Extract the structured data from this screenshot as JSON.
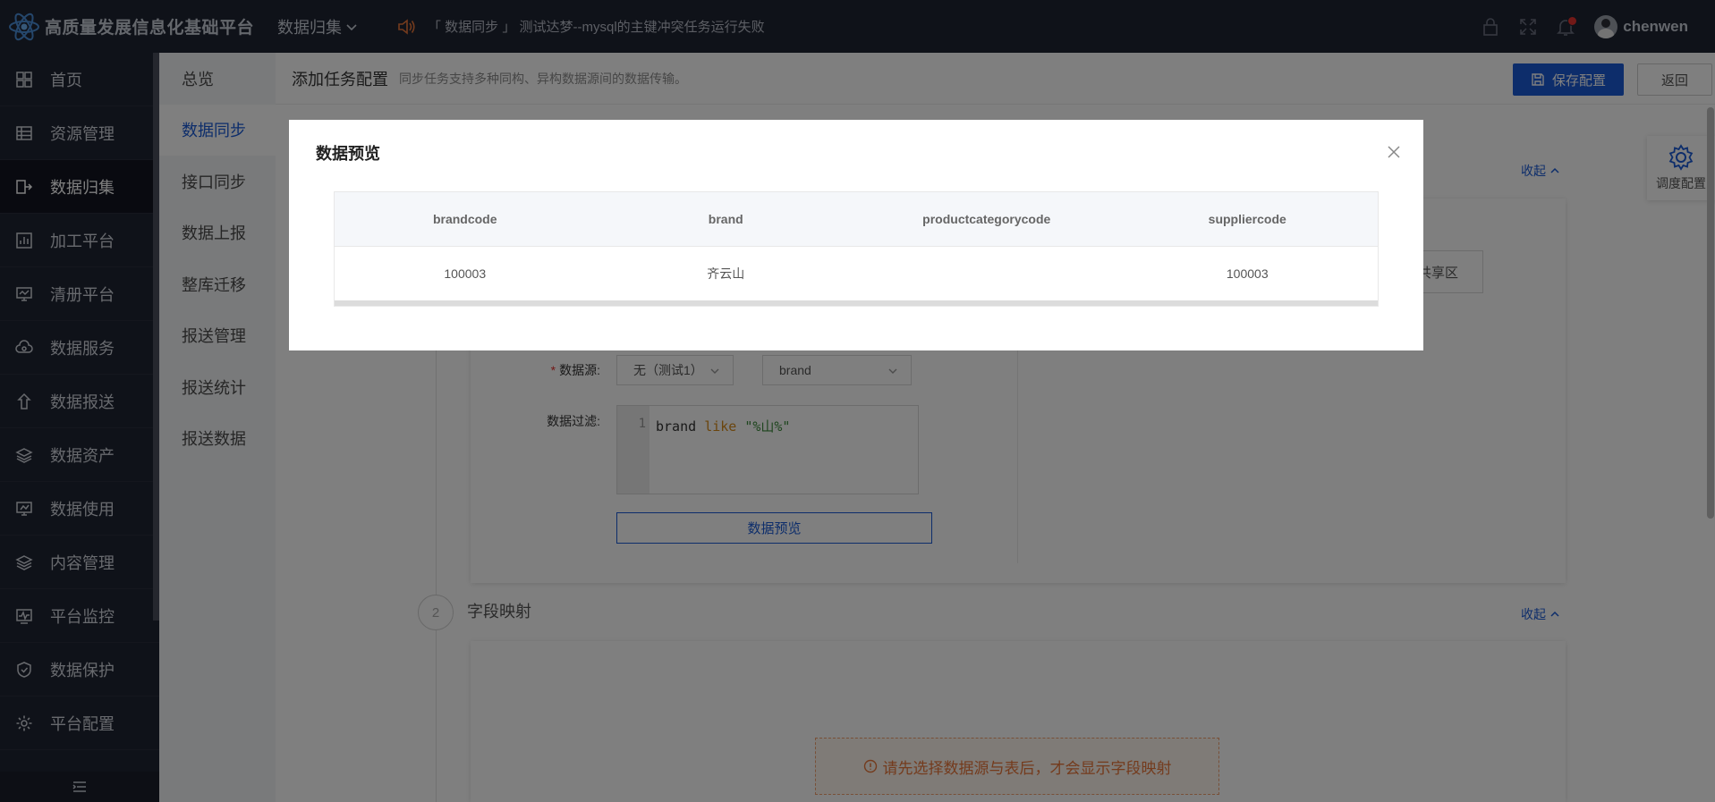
{
  "app": {
    "title": "高质量发展信息化基础平台",
    "module": "数据归集",
    "notice": "「 数据同步 」 测试达梦--mysql的主键冲突任务运行失败",
    "user": "chenwen"
  },
  "sidebar": {
    "items": [
      {
        "label": "首页",
        "icon": "dashboard-icon"
      },
      {
        "label": "资源管理",
        "icon": "table-icon"
      },
      {
        "label": "数据归集",
        "icon": "collect-icon"
      },
      {
        "label": "加工平台",
        "icon": "chart-icon"
      },
      {
        "label": "清册平台",
        "icon": "monitor-icon"
      },
      {
        "label": "数据服务",
        "icon": "cloud-icon"
      },
      {
        "label": "数据报送",
        "icon": "upload-icon"
      },
      {
        "label": "数据资产",
        "icon": "layers-icon"
      },
      {
        "label": "数据使用",
        "icon": "screen-icon"
      },
      {
        "label": "内容管理",
        "icon": "stack-icon"
      },
      {
        "label": "平台监控",
        "icon": "pulse-icon"
      },
      {
        "label": "数据保护",
        "icon": "shield-icon"
      },
      {
        "label": "平台配置",
        "icon": "gear-icon"
      }
    ]
  },
  "submenu": {
    "items": [
      "总览",
      "数据同步",
      "接口同步",
      "数据上报",
      "整库迁移",
      "报送管理",
      "报送统计",
      "报送数据"
    ]
  },
  "main": {
    "title": "添加任务配置",
    "description": "同步任务支持多种同构、异构数据源间的数据传输。",
    "save_label": "保存配置",
    "back_label": "返回",
    "collapse_label": "收起",
    "partial_select": "共享区",
    "datasource_label": "数据源:",
    "datasource_value": "无（测试1）",
    "table_value": "brand",
    "filter_label": "数据过滤:",
    "filter_line_no": "1",
    "filter_code": {
      "part1": "brand ",
      "keyword": "like",
      "part2": " ",
      "string": "\"%山%\""
    },
    "preview_button": "数据预览",
    "step2_number": "2",
    "step2_title": "字段映射",
    "warning": "请先选择数据源与表后，才会显示字段映射",
    "float_panel": "调度配置"
  },
  "modal": {
    "title": "数据预览",
    "columns": [
      "brandcode",
      "brand",
      "productcategorycode",
      "suppliercode"
    ],
    "rows": [
      [
        "100003",
        "齐云山",
        "",
        "100003"
      ]
    ]
  }
}
